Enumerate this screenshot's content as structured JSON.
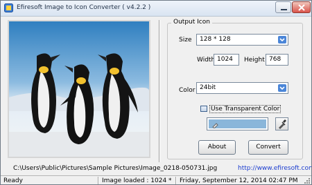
{
  "window": {
    "title": "Efiresoft Image to Icon Converter ( v4.2.2 )"
  },
  "preview": {
    "image_icon": "penguins-photo"
  },
  "output": {
    "group_title": "Output Icon",
    "size_label": "Size",
    "size_value": "128 * 128",
    "width_label": "Width",
    "width_value": "1024",
    "height_label": "Height",
    "height_value": "768",
    "color_label": "Color",
    "color_value": "24bit",
    "transparent_label": "Use Transparent Color",
    "transparent_checked": false,
    "transparent_color": "#8ab6da",
    "about_label": "About",
    "convert_label": "Convert"
  },
  "file_path": "C:\\Users\\Public\\Pictures\\Sample Pictures\\Image_0218-050731.jpg",
  "website": "http://www.efiresoft.com",
  "status": {
    "ready": "Ready",
    "image_loaded": "Image loaded : 1024 * ...",
    "datetime": "Friday, September 12, 2014 02:47 PM"
  }
}
